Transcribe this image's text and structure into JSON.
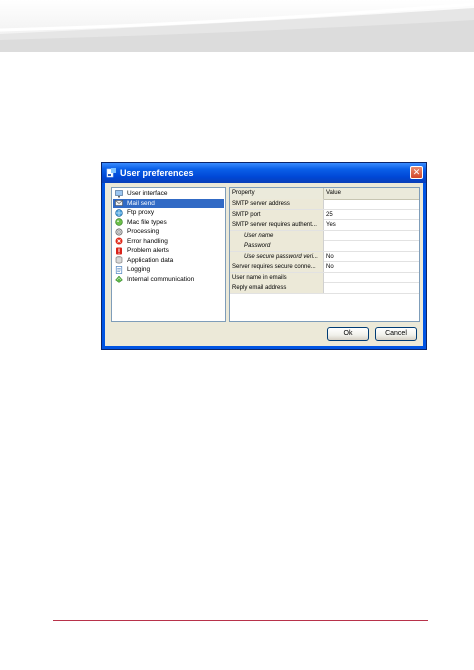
{
  "dialog": {
    "title": "User preferences",
    "close_glyph": "✕",
    "tree": [
      {
        "label": "User interface",
        "icon": "monitor-icon",
        "selected": false
      },
      {
        "label": "Mail send",
        "icon": "mail-icon",
        "selected": true
      },
      {
        "label": "Ftp proxy",
        "icon": "network-icon",
        "selected": false
      },
      {
        "label": "Mac file types",
        "icon": "mac-file-icon",
        "selected": false
      },
      {
        "label": "Processing",
        "icon": "gear-icon",
        "selected": false
      },
      {
        "label": "Error handling",
        "icon": "error-icon",
        "selected": false
      },
      {
        "label": "Problem alerts",
        "icon": "alert-icon",
        "selected": false
      },
      {
        "label": "Application data",
        "icon": "database-icon",
        "selected": false
      },
      {
        "label": "Logging",
        "icon": "document-icon",
        "selected": false
      },
      {
        "label": "Internal communication",
        "icon": "communication-icon",
        "selected": false
      }
    ],
    "grid": {
      "headers": {
        "property": "Property",
        "value": "Value"
      },
      "rows": [
        {
          "property": "SMTP server address",
          "value": "",
          "sub": false
        },
        {
          "property": "SMTP port",
          "value": "25",
          "sub": false
        },
        {
          "property": "SMTP server requires authent...",
          "value": "Yes",
          "sub": false
        },
        {
          "property": "User name",
          "value": "",
          "sub": true
        },
        {
          "property": "Password",
          "value": "",
          "sub": true
        },
        {
          "property": "Use secure password veri...",
          "value": "No",
          "sub": true
        },
        {
          "property": "Server requires secure conne...",
          "value": "No",
          "sub": false
        },
        {
          "property": "User name in emails",
          "value": "",
          "sub": false
        },
        {
          "property": "Reply email address",
          "value": "",
          "sub": false
        }
      ]
    },
    "buttons": {
      "ok": "Ok",
      "cancel": "Cancel"
    }
  },
  "colors": {
    "selection": "#316ac5",
    "titlebar": "#0a5fe8",
    "dialog_bg": "#ece9d8",
    "footer_rule": "#b8324a"
  }
}
